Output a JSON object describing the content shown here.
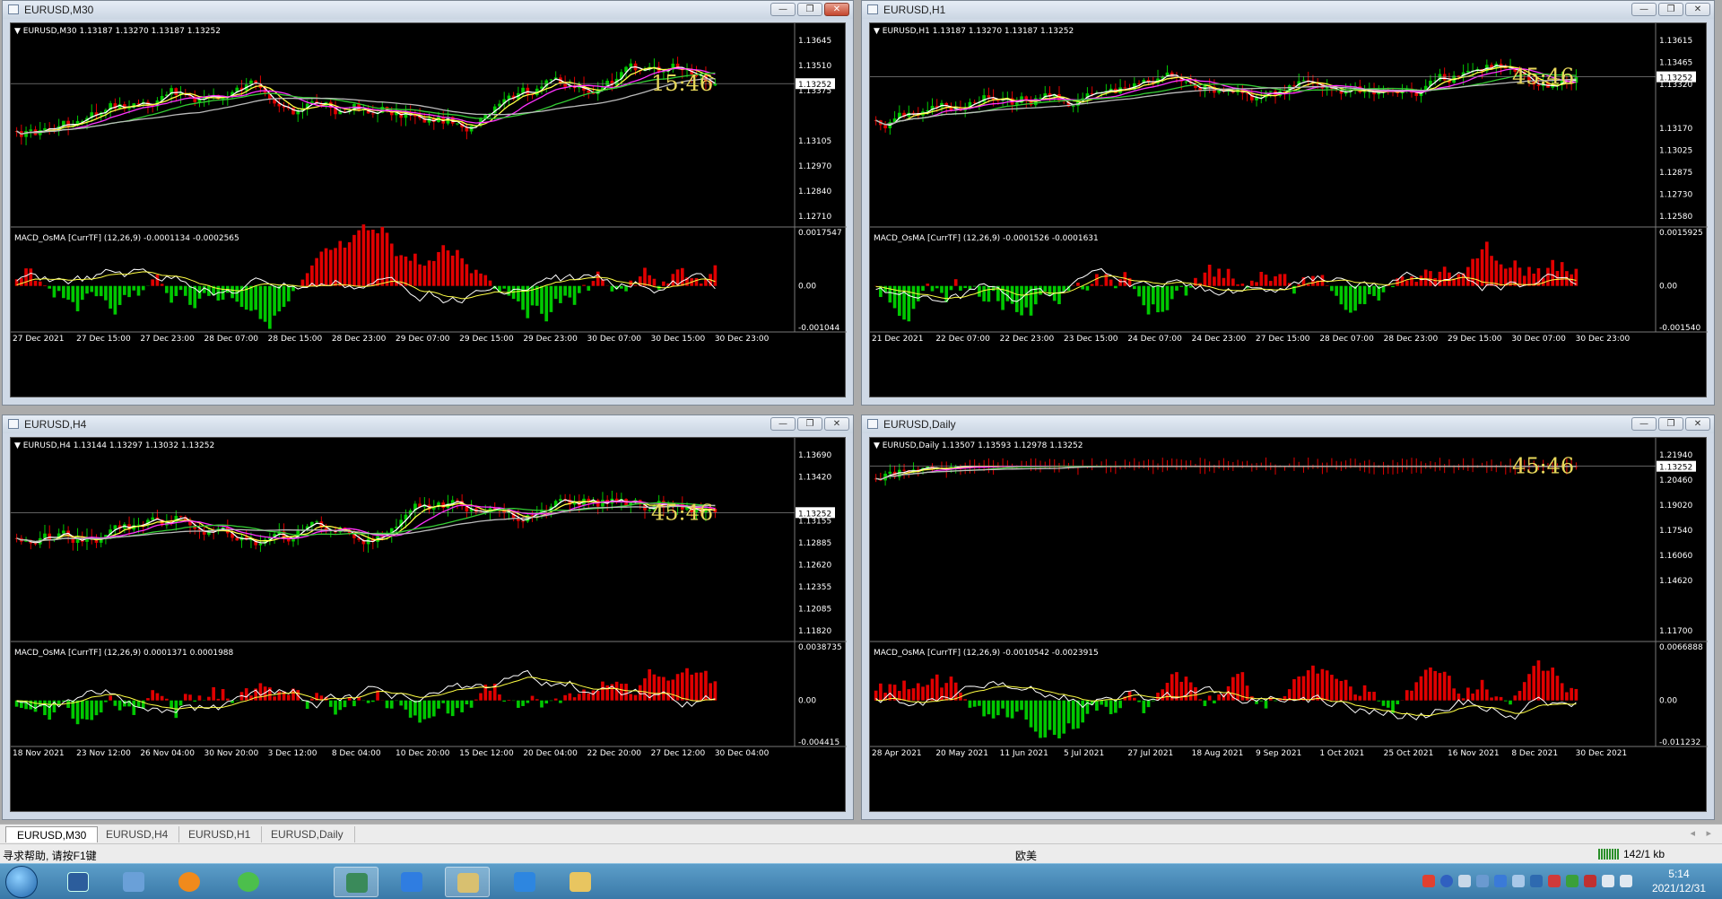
{
  "windows": [
    {
      "key": "m30",
      "title": "EURUSD,M30",
      "price_header": "EURUSD,M30  1.13187 1.13270 1.13187 1.13252",
      "price_ticks": [
        "1.13645",
        "1.13510",
        "1.13375",
        "1.13252",
        "1.13105",
        "1.12970",
        "1.12840",
        "1.12710"
      ],
      "current_price": "1.13252",
      "indicator_header": "MACD_OsMA [CurrTF] (12,26,9) -0.0001134 -0.0002565",
      "indicator_ticks": [
        "0.0017547",
        "0.00",
        "-0.001044"
      ],
      "time_labels": [
        "27 Dec 2021",
        "27 Dec 15:00",
        "27 Dec 23:00",
        "28 Dec 07:00",
        "28 Dec 15:00",
        "28 Dec 23:00",
        "29 Dec 07:00",
        "29 Dec 15:00",
        "29 Dec 23:00",
        "30 Dec 07:00",
        "30 Dec 15:00",
        "30 Dec 23:00"
      ],
      "timer": "15:46",
      "active": true
    },
    {
      "key": "h1",
      "title": "EURUSD,H1",
      "price_header": "EURUSD,H1  1.13187 1.13270 1.13187 1.13252",
      "price_ticks": [
        "1.13615",
        "1.13465",
        "1.13320",
        "1.13252",
        "1.13170",
        "1.13025",
        "1.12875",
        "1.12730",
        "1.12580"
      ],
      "current_price": "1.13252",
      "indicator_header": "MACD_OsMA [CurrTF] (12,26,9) -0.0001526 -0.0001631",
      "indicator_ticks": [
        "0.0015925",
        "0.00",
        "-0.001540"
      ],
      "time_labels": [
        "21 Dec 2021",
        "22 Dec 07:00",
        "22 Dec 23:00",
        "23 Dec 15:00",
        "24 Dec 07:00",
        "24 Dec 23:00",
        "27 Dec 15:00",
        "28 Dec 07:00",
        "28 Dec 23:00",
        "29 Dec 15:00",
        "30 Dec 07:00",
        "30 Dec 23:00"
      ],
      "timer": "45:46",
      "active": false
    },
    {
      "key": "h4",
      "title": "EURUSD,H4",
      "price_header": "EURUSD,H4  1.13144 1.13297 1.13032 1.13252",
      "price_ticks": [
        "1.13690",
        "1.13420",
        "1.13252",
        "1.13155",
        "1.12885",
        "1.12620",
        "1.12355",
        "1.12085",
        "1.11820"
      ],
      "current_price": "1.13252",
      "indicator_header": "MACD_OsMA [CurrTF] (12,26,9) 0.0001371 0.0001988",
      "indicator_ticks": [
        "0.0038735",
        "0.00",
        "-0.004415"
      ],
      "time_labels": [
        "18 Nov 2021",
        "23 Nov 12:00",
        "26 Nov 04:00",
        "30 Nov 20:00",
        "3 Dec 12:00",
        "8 Dec 04:00",
        "10 Dec 20:00",
        "15 Dec 12:00",
        "20 Dec 04:00",
        "22 Dec 20:00",
        "27 Dec 12:00",
        "30 Dec 04:00"
      ],
      "timer": "45:46",
      "active": false
    },
    {
      "key": "d1",
      "title": "EURUSD,Daily",
      "price_header": "EURUSD,Daily  1.13507 1.13593 1.12978 1.13252",
      "price_ticks": [
        "1.21940",
        "1.20460",
        "1.19020",
        "1.17540",
        "1.16060",
        "1.14620",
        "1.13252",
        "1.11700"
      ],
      "current_price": "1.13252",
      "indicator_header": "MACD_OsMA [CurrTF] (12,26,9) -0.0010542 -0.0023915",
      "indicator_ticks": [
        "0.0066888",
        "0.00",
        "-0.011232"
      ],
      "time_labels": [
        "28 Apr 2021",
        "20 May 2021",
        "11 Jun 2021",
        "5 Jul 2021",
        "27 Jul 2021",
        "18 Aug 2021",
        "9 Sep 2021",
        "1 Oct 2021",
        "25 Oct 2021",
        "16 Nov 2021",
        "8 Dec 2021",
        "30 Dec 2021"
      ],
      "timer": "45:46",
      "active": false
    }
  ],
  "tabs": [
    "EURUSD,M30",
    "EURUSD,H4",
    "EURUSD,H1",
    "EURUSD,Daily"
  ],
  "active_tab": "EURUSD,M30",
  "status": {
    "help": "寻求帮助, 请按F1键",
    "profile": "欧美",
    "traffic": "142/1 kb"
  },
  "clock": {
    "time": "5:14",
    "date": "2021/12/31"
  },
  "colors": {
    "bull": "#00c800",
    "bear": "#e00000",
    "ma_white": "#ffffff",
    "ma_yellow": "#ffff44",
    "ma_magenta": "#ff33ff",
    "ma_green": "#33cc33",
    "ma_gray": "#bbbbbb",
    "timer": "#e8d85a"
  }
}
